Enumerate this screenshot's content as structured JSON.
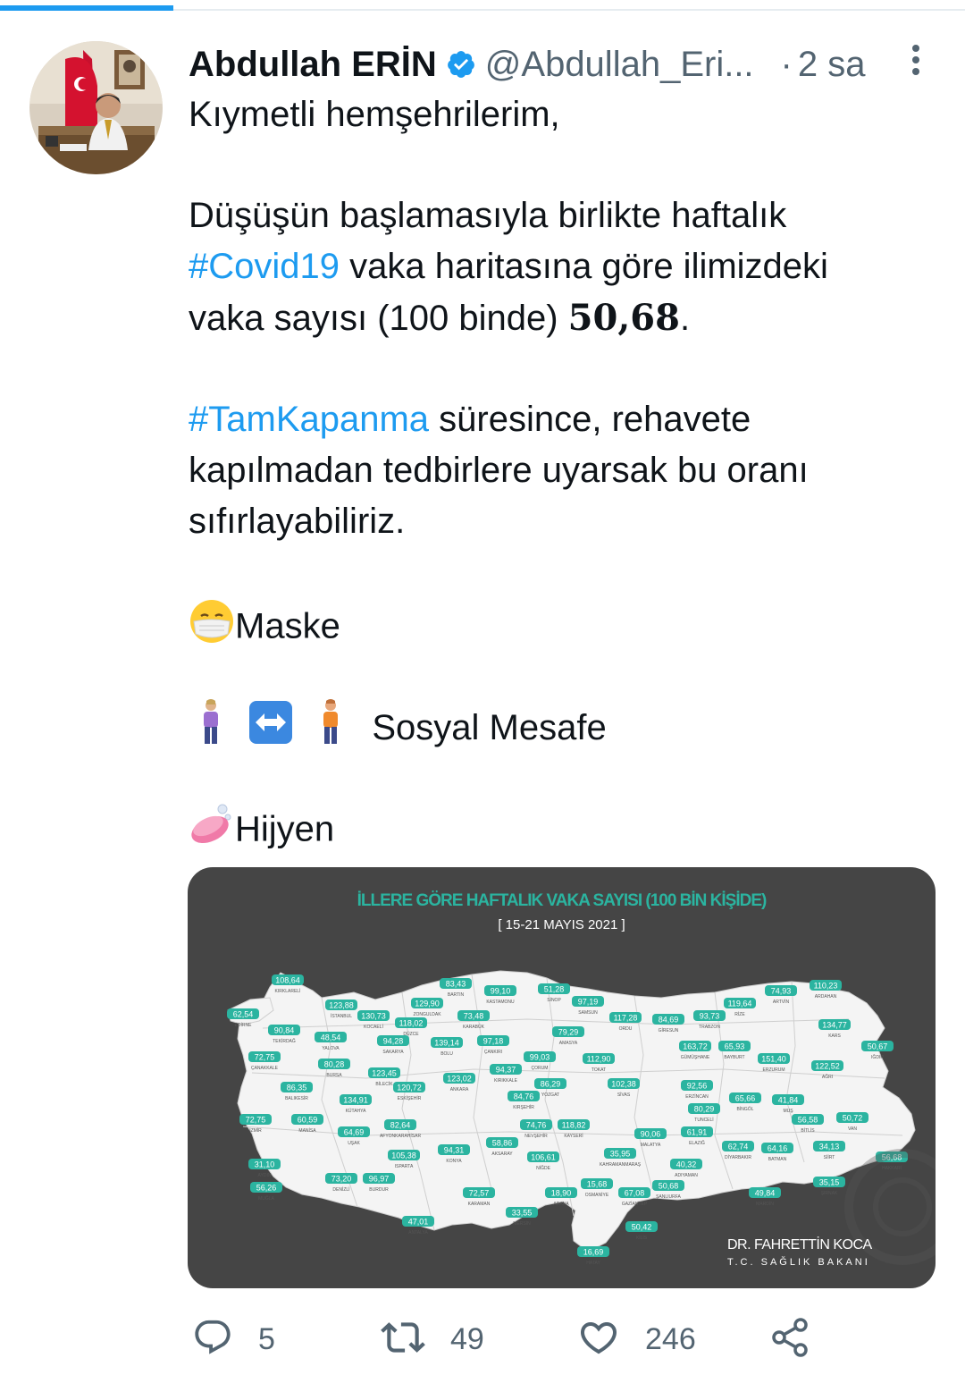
{
  "colors": {
    "accent": "#1d9bf0",
    "text": "#0f1419",
    "muted": "#536471",
    "map_bg": "#454545",
    "map_teal": "#2bb4a0"
  },
  "loading": {
    "progress_fraction": 0.18
  },
  "tweet": {
    "author_name": "Abdullah ERİN",
    "verified_icon": "verified-badge-icon",
    "handle": "@Abdullah_Eri...",
    "dot": "·",
    "time": "2 sa",
    "lines": {
      "l1": "Kıymetli hemşehrilerim,",
      "l2": "Düşüşün başlamasıyla birlikte haftalık",
      "l3_tag": "#Covid19",
      "l3_rest": " vaka haritasına göre ilimizdeki",
      "l4_a": "vaka sayısı (100 binde) ",
      "l4_num": "50,68",
      "l4_b": ".",
      "l5_tag": "#TamKapanma",
      "l5_rest": " süresince, rehavete",
      "l6": "kapılmadan tedbirlere uyarsak bu oranı",
      "l7": "sıfırlayabiliriz.",
      "l8": "Maske",
      "l9": "Sosyal Mesafe",
      "l10": "Hijyen"
    }
  },
  "media": {
    "title": "İLLERE GÖRE HAFTALIK VAKA SAYISI (100 BİN KİŞİDE)",
    "subtitle": "[ 15-21 MAYIS 2021 ]",
    "signature_name": "DR. FAHRETTİN KOCA",
    "signature_title": "T.C. SAĞLIK BAKANI",
    "provinces": [
      {
        "name": "KIRKLARELİ",
        "value": "108,64"
      },
      {
        "name": "EDİRNE",
        "value": "62,54"
      },
      {
        "name": "TEKİRDAĞ",
        "value": "90,84"
      },
      {
        "name": "İSTANBUL",
        "value": "123,88"
      },
      {
        "name": "KOCAELİ",
        "value": "130,73"
      },
      {
        "name": "YALOVA",
        "value": "48,54"
      },
      {
        "name": "SAKARYA",
        "value": "94,28"
      },
      {
        "name": "DÜZCE",
        "value": "118,02"
      },
      {
        "name": "ZONGULDAK",
        "value": "129,90"
      },
      {
        "name": "BARTIN",
        "value": "83,43"
      },
      {
        "name": "KARABÜK",
        "value": "73,48"
      },
      {
        "name": "KASTAMONU",
        "value": "99,10"
      },
      {
        "name": "SİNOP",
        "value": "51,28"
      },
      {
        "name": "SAMSUN",
        "value": "97,19"
      },
      {
        "name": "ORDU",
        "value": "117,28"
      },
      {
        "name": "GİRESUN",
        "value": "84,69"
      },
      {
        "name": "TRABZON",
        "value": "93,73"
      },
      {
        "name": "RİZE",
        "value": "119,64"
      },
      {
        "name": "ARTVİN",
        "value": "74,93"
      },
      {
        "name": "ARDAHAN",
        "value": "110,23"
      },
      {
        "name": "KARS",
        "value": "134,77"
      },
      {
        "name": "IĞDIR",
        "value": "50,67"
      },
      {
        "name": "ÇANAKKALE",
        "value": "72,75"
      },
      {
        "name": "BURSA",
        "value": "80,28"
      },
      {
        "name": "BİLECİK",
        "value": "123,45"
      },
      {
        "name": "BOLU",
        "value": "139,14"
      },
      {
        "name": "ÇANKIRI",
        "value": "97,18"
      },
      {
        "name": "ÇORUM",
        "value": "99,03"
      },
      {
        "name": "AMASYA",
        "value": "79,29"
      },
      {
        "name": "TOKAT",
        "value": "112,90"
      },
      {
        "name": "GÜMÜŞHANE",
        "value": "163,72"
      },
      {
        "name": "BAYBURT",
        "value": "65,93"
      },
      {
        "name": "ERZURUM",
        "value": "151,40"
      },
      {
        "name": "AĞRI",
        "value": "122,52"
      },
      {
        "name": "BALIKESİR",
        "value": "86,35"
      },
      {
        "name": "KÜTAHYA",
        "value": "134,91"
      },
      {
        "name": "ESKİŞEHİR",
        "value": "120,72"
      },
      {
        "name": "ANKARA",
        "value": "123,02"
      },
      {
        "name": "KIRIKKALE",
        "value": "94,37"
      },
      {
        "name": "YOZGAT",
        "value": "86,29"
      },
      {
        "name": "SİVAS",
        "value": "102,38"
      },
      {
        "name": "ERZİNCAN",
        "value": "92,56"
      },
      {
        "name": "TUNCELİ",
        "value": "80,29"
      },
      {
        "name": "BİNGÖL",
        "value": "65,66"
      },
      {
        "name": "MUŞ",
        "value": "41,84"
      },
      {
        "name": "İZMİR",
        "value": "72,75"
      },
      {
        "name": "MANİSA",
        "value": "60,59"
      },
      {
        "name": "UŞAK",
        "value": "64,69"
      },
      {
        "name": "AFYONKARAHİSAR",
        "value": "82,64"
      },
      {
        "name": "KIRŞEHİR",
        "value": "84,76"
      },
      {
        "name": "NEVŞEHİR",
        "value": "74,76"
      },
      {
        "name": "KAYSERİ",
        "value": "118,82"
      },
      {
        "name": "MALATYA",
        "value": "90,06"
      },
      {
        "name": "ELAZIĞ",
        "value": "61,91"
      },
      {
        "name": "BİTLİS",
        "value": "56,58"
      },
      {
        "name": "VAN",
        "value": "50,72"
      },
      {
        "name": "AYDIN",
        "value": "31,10"
      },
      {
        "name": "DENİZLİ",
        "value": "73,20"
      },
      {
        "name": "ISPARTA",
        "value": "105,38"
      },
      {
        "name": "KONYA",
        "value": "94,31"
      },
      {
        "name": "AKSARAY",
        "value": "58,86"
      },
      {
        "name": "NİĞDE",
        "value": "106,61"
      },
      {
        "name": "KAHRAMANMARAŞ",
        "value": "35,95"
      },
      {
        "name": "ADIYAMAN",
        "value": "40,32"
      },
      {
        "name": "DİYARBAKIR",
        "value": "62,74"
      },
      {
        "name": "BATMAN",
        "value": "64,16"
      },
      {
        "name": "SİİRT",
        "value": "34,13"
      },
      {
        "name": "HAKKARİ",
        "value": "56,68"
      },
      {
        "name": "MUĞLA",
        "value": "56,26"
      },
      {
        "name": "BURDUR",
        "value": "96,97"
      },
      {
        "name": "KARAMAN",
        "value": "72,57"
      },
      {
        "name": "ADANA",
        "value": "18,90"
      },
      {
        "name": "OSMANİYE",
        "value": "15,68"
      },
      {
        "name": "GAZİANTEP",
        "value": "67,08"
      },
      {
        "name": "ŞANLIURFA",
        "value": "50,68"
      },
      {
        "name": "MARDİN",
        "value": "49,84"
      },
      {
        "name": "ŞIRNAK",
        "value": "35,15"
      },
      {
        "name": "ANTALYA",
        "value": "47,01"
      },
      {
        "name": "MERSİN",
        "value": "33,55"
      },
      {
        "name": "KİLİS",
        "value": "50,42"
      },
      {
        "name": "HATAY",
        "value": "16,69"
      }
    ]
  },
  "actions": {
    "reply_icon": "reply-icon",
    "reply_count": "5",
    "retweet_icon": "retweet-icon",
    "retweet_count": "49",
    "like_icon": "heart-icon",
    "like_count": "246",
    "share_icon": "share-icon"
  }
}
